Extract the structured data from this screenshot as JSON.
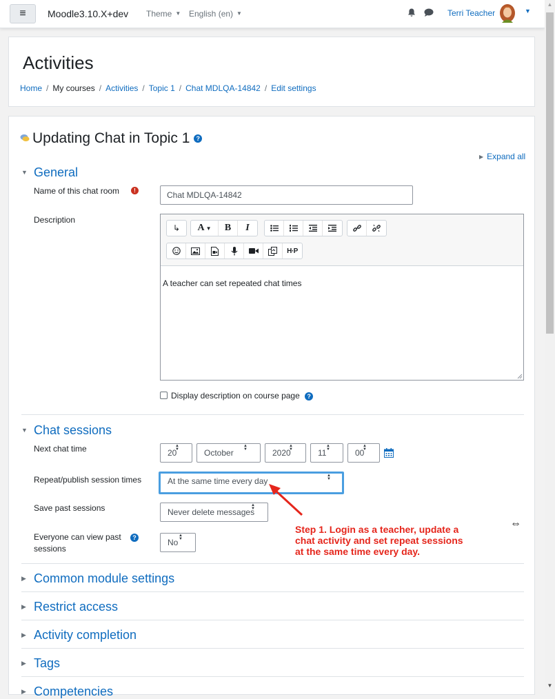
{
  "navbar": {
    "menu_icon": "hamburger-icon",
    "brand": "Moodle3.10.X+dev",
    "theme": "Theme",
    "language": "English (en)",
    "notifications_icon": "bell-icon",
    "messages_icon": "chat-bubble-icon",
    "user_name": "Terri Teacher"
  },
  "header": {
    "title": "Activities",
    "breadcrumb": [
      "Home",
      "My courses",
      "Activities",
      "Topic 1",
      "Chat MDLQA-14842",
      "Edit settings"
    ]
  },
  "form": {
    "title": "Updating Chat in Topic 1",
    "expand_all": "Expand all",
    "general": {
      "heading": "General",
      "name_label": "Name of this chat room",
      "name_value": "Chat MDLQA-14842",
      "description_label": "Description",
      "description_text": "A teacher can set repeated chat times",
      "display_description_label": "Display description on course page"
    },
    "chat_sessions": {
      "heading": "Chat sessions",
      "next_chat_time_label": "Next chat time",
      "day": "20",
      "month": "October",
      "year": "2020",
      "hour": "11",
      "minute": "00",
      "repeat_label": "Repeat/publish session times",
      "repeat_value": "At the same time every day",
      "save_past_label": "Save past sessions",
      "save_past_value": "Never delete messages",
      "everyone_view_label": "Everyone can view past sessions",
      "everyone_view_value": "No"
    },
    "collapsed_sections": [
      "Common module settings",
      "Restrict access",
      "Activity completion",
      "Tags",
      "Competencies"
    ]
  },
  "annotation": {
    "text": "Step 1. Login as a teacher, update a\nchat activity and set repeat sessions\nat the same time every day.",
    "color": "#e5261c"
  },
  "colors": {
    "link": "#0f6cbf",
    "focus_border": "#4a9ee0",
    "required": "#ca3120"
  }
}
